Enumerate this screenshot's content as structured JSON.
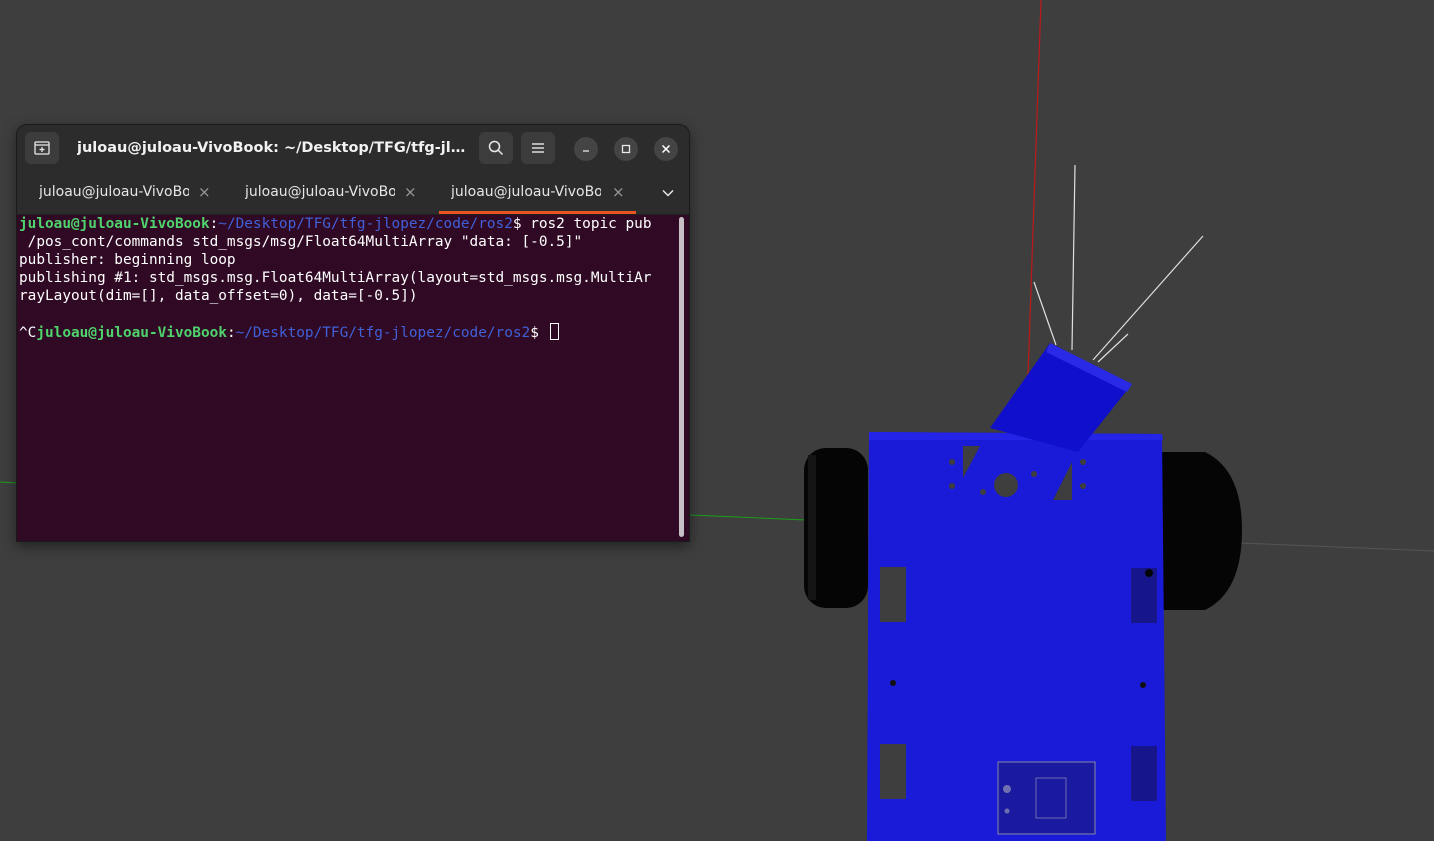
{
  "window": {
    "title": "juloau@juloau-VivoBook: ~/Desktop/TFG/tfg-jlopez..."
  },
  "tabs": [
    {
      "label": "juloau@juloau-VivoBo...",
      "active": false
    },
    {
      "label": "juloau@juloau-VivoBo...",
      "active": false
    },
    {
      "label": "juloau@juloau-VivoBo...",
      "active": true
    }
  ],
  "terminal": {
    "prompt_user": "juloau@juloau-VivoBook",
    "prompt_sep": ":",
    "prompt_path": "~/Desktop/TFG/tfg-jlopez/code/ros2",
    "prompt_symbol": "$",
    "command_1": " ros2 topic pub",
    "line_2": " /pos_cont/commands std_msgs/msg/Float64MultiArray \"data: [-0.5]\"",
    "line_3": "publisher: beginning loop",
    "line_4": "publishing #1: std_msgs.msg.Float64MultiArray(layout=std_msgs.msg.MultiAr",
    "line_5": "rayLayout(dim=[], data_offset=0), data=[-0.5])",
    "interrupt": "^C"
  },
  "colors": {
    "terminal_bg": "#300a24",
    "prompt_user": "#4fd36c",
    "prompt_path": "#4060d8",
    "active_tab_indicator": "#e95420",
    "robot_body": "#1a1ad9",
    "viewport_bg": "#3e3e3e"
  },
  "icons": {
    "new_tab": "new-tab-icon",
    "search": "search-icon",
    "menu": "hamburger-menu-icon",
    "minimize": "minimize-icon",
    "maximize": "maximize-icon",
    "close": "close-icon",
    "tabs_dropdown": "chevron-down-icon"
  }
}
